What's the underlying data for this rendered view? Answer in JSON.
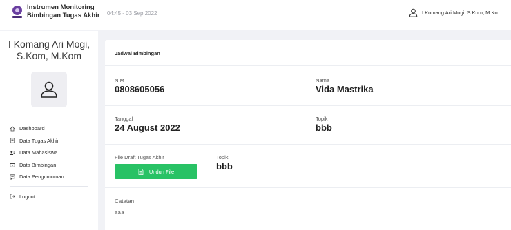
{
  "header": {
    "app_title_line1": "Instrumen Monitoring",
    "app_title_line2": "Bimbingan Tugas Akhir",
    "datetime": "04:45 - 03 Sep 2022",
    "user_name": "I Komang Ari Mogi, S.Kom, M.Ko"
  },
  "sidebar": {
    "name_line1": "I Komang Ari Mogi,",
    "name_line2": "S.Kom, M.Kom",
    "items": [
      {
        "label": "Dashboard",
        "icon": "home-icon"
      },
      {
        "label": "Data Tugas Akhir",
        "icon": "document-icon"
      },
      {
        "label": "Data Mahasiswa",
        "icon": "users-icon"
      },
      {
        "label": "Data Bimbingan",
        "icon": "calendar-icon"
      },
      {
        "label": "Data Pengumuman",
        "icon": "announcement-icon"
      }
    ],
    "logout_label": "Logout"
  },
  "card": {
    "title": "Jadwal Bimbingan",
    "nim_label": "NIM",
    "nim_value": "0808605056",
    "nama_label": "Nama",
    "nama_value": "Vida Mastrika",
    "tanggal_label": "Tanggal",
    "tanggal_value": "24 August 2022",
    "topik_label": "Topik",
    "topik_value": "bbb",
    "file_label": "File Draft Tugas Akhir",
    "download_label": "Unduh File",
    "topik2_label": "Topik",
    "topik2_value": "bbb",
    "catatan_label": "Catatan",
    "catatan_value": "aaa"
  },
  "colors": {
    "accent_green": "#28c265",
    "logo_purple": "#6a3fa0",
    "background": "#f1f2f6"
  }
}
